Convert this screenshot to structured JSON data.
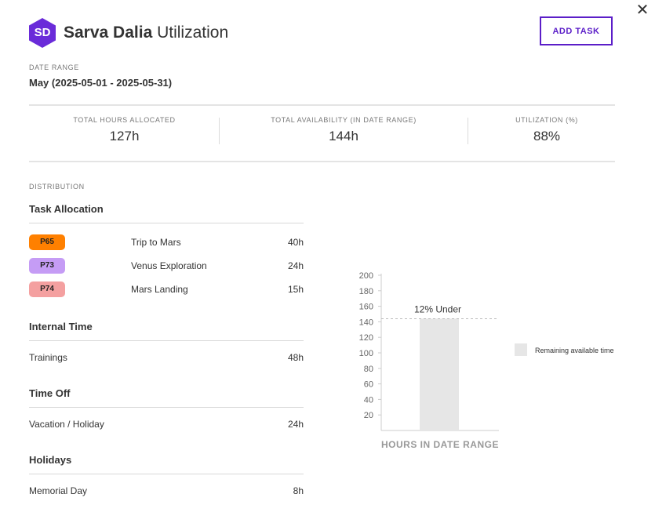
{
  "header": {
    "avatar_initials": "SD",
    "avatar_color": "#6a2bd9",
    "name": "Sarva Dalia",
    "suffix": "Utilization",
    "add_task_label": "ADD TASK",
    "close_glyph": "✕"
  },
  "date_range": {
    "label": "DATE RANGE",
    "value": "May (2025-05-01 - 2025-05-31)"
  },
  "stats": [
    {
      "label": "TOTAL HOURS ALLOCATED",
      "value": "127h"
    },
    {
      "label": "TOTAL AVAILABILITY (IN DATE RANGE)",
      "value": "144h"
    },
    {
      "label": "UTILIZATION (%)",
      "value": "88%"
    }
  ],
  "distribution": {
    "label": "DISTRIBUTION",
    "task_allocation": {
      "title": "Task Allocation",
      "items": [
        {
          "badge": "P65",
          "color": "#ff8000",
          "name": "Trip to Mars",
          "hours": "40h"
        },
        {
          "badge": "P73",
          "color": "#c59cf5",
          "name": "Venus Exploration",
          "hours": "24h"
        },
        {
          "badge": "P74",
          "color": "#f4a0a0",
          "name": "Mars Landing",
          "hours": "15h"
        }
      ]
    },
    "internal_time": {
      "title": "Internal Time",
      "items": [
        {
          "name": "Trainings",
          "hours": "48h"
        }
      ]
    },
    "time_off": {
      "title": "Time Off",
      "items": [
        {
          "name": "Vacation / Holiday",
          "hours": "24h"
        }
      ]
    },
    "holidays": {
      "title": "Holidays",
      "items": [
        {
          "name": "Memorial Day",
          "hours": "8h"
        }
      ]
    }
  },
  "chart_data": {
    "type": "bar",
    "categories": [
      ""
    ],
    "values": [
      144
    ],
    "xlabel": "HOURS IN DATE RANGE",
    "ylabel": "",
    "ylim": [
      0,
      200
    ],
    "yticks": [
      20,
      40,
      60,
      80,
      100,
      120,
      140,
      160,
      180,
      200
    ],
    "annotation": "12% Under",
    "reference_line": 144,
    "legend": [
      {
        "name": "Remaining available time",
        "color": "#e6e6e6"
      }
    ],
    "legend_position": "right"
  }
}
